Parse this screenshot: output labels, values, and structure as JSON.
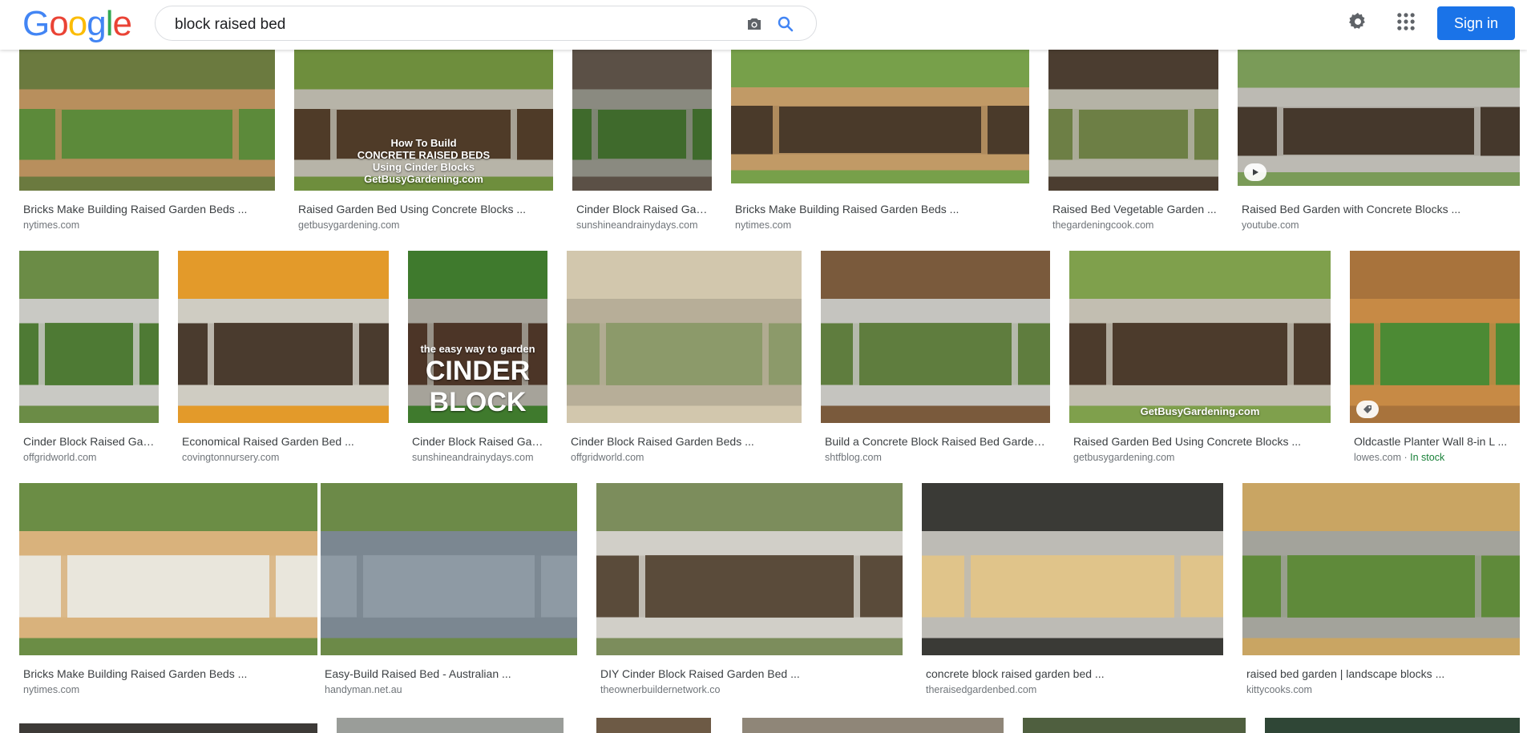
{
  "header": {
    "search_query": "block raised bed",
    "sign_in_label": "Sign in",
    "logo_text": "Google",
    "logo_colors": [
      "#4285f4",
      "#ea4335",
      "#fbbc05",
      "#4285f4",
      "#34a853",
      "#ea4335"
    ]
  },
  "results": [
    {
      "caption": "Bricks Make Building Raised Garden Beds ...",
      "domain": "nytimes.com",
      "img": [
        "#b88f5d",
        "#5c8a3a",
        "#6b7a3f"
      ]
    },
    {
      "caption": "Raised Garden Bed Using Concrete Blocks ...",
      "domain": "getbusygardening.com",
      "img": [
        "#b7b4a8",
        "#4f3b28",
        "#6e8e3d"
      ],
      "overlay": [
        "How To Build",
        "CONCRETE RAISED BEDS",
        "Using Cinder Blocks",
        "GetBusyGardening.com"
      ]
    },
    {
      "caption": "Cinder Block Raised Garden Beds ...",
      "domain": "sunshineandrainydays.com",
      "img": [
        "#8a8a80",
        "#3f6a2c",
        "#5b5046"
      ]
    },
    {
      "caption": "Bricks Make Building Raised Garden Beds ...",
      "domain": "nytimes.com",
      "img": [
        "#c19a66",
        "#4a3a2a",
        "#77a04a"
      ]
    },
    {
      "caption": "Raised Bed Vegetable Garden ...",
      "domain": "thegardeningcook.com",
      "img": [
        "#b5b3a6",
        "#6d7f45",
        "#4b3d30"
      ]
    },
    {
      "caption": "Raised Bed Garden with Concrete Blocks ...",
      "domain": "youtube.com",
      "img": [
        "#bcbab3",
        "#45382c",
        "#7a9b58"
      ],
      "badge": "play"
    },
    {
      "caption": "Cinder Block Raised Garden Beds ...",
      "domain": "offgridworld.com",
      "img": [
        "#c9c9c4",
        "#4e7a34",
        "#6b8c46"
      ]
    },
    {
      "caption": "Economical Raised Garden Bed ...",
      "domain": "covingtonnursery.com",
      "img": [
        "#cfccc2",
        "#4a3b2e",
        "#e39a2a"
      ]
    },
    {
      "caption": "Cinder Block Raised Garden Beds ...",
      "domain": "sunshineandrainydays.com",
      "img": [
        "#a6a39a",
        "#4c3527",
        "#3f7a2d"
      ],
      "overlay": [
        "the easy way to garden",
        "CINDER",
        "BLOCK"
      ]
    },
    {
      "caption": "Cinder Block Raised Garden Beds ...",
      "domain": "offgridworld.com",
      "img": [
        "#b7ae98",
        "#8c9a6a",
        "#d2c7ad"
      ]
    },
    {
      "caption": "Build a Concrete Block Raised Bed Garden ...",
      "domain": "shtfblog.com",
      "img": [
        "#c5c4bf",
        "#5f7d3e",
        "#7a5a3c"
      ]
    },
    {
      "caption": "Raised Garden Bed Using Concrete Blocks ...",
      "domain": "getbusygardening.com",
      "img": [
        "#c2beb1",
        "#4c3b2c",
        "#7fa04c"
      ],
      "overlay": [
        "GetBusyGardening.com"
      ]
    },
    {
      "caption": "Oldcastle Planter Wall 8-in L ...",
      "domain": "lowes.com",
      "stock": "In stock",
      "img": [
        "#c78a45",
        "#4c8a34",
        "#a8733c"
      ],
      "badge": "tag"
    },
    {
      "caption": "Bricks Make Building Raised Garden Beds ...",
      "domain": "nytimes.com",
      "img": [
        "#d9b27c",
        "#e9e6dc",
        "#6b8d45"
      ]
    },
    {
      "caption": "Easy-Build Raised Bed - Australian ...",
      "domain": "handyman.net.au",
      "img": [
        "#7b8791",
        "#8e9aa4",
        "#6c8a48"
      ]
    },
    {
      "caption": "DIY Cinder Block Raised Garden Bed ...",
      "domain": "theownerbuildernetwork.co",
      "img": [
        "#d1cfc8",
        "#5a4b3a",
        "#7c8d5c"
      ]
    },
    {
      "caption": "concrete block raised garden bed ...",
      "domain": "theraisedgardenbed.com",
      "img": [
        "#bdbbb5",
        "#e0c48a",
        "#3a3a36"
      ]
    },
    {
      "caption": "raised bed garden | landscape blocks ...",
      "domain": "kittycooks.com",
      "img": [
        "#a3a39b",
        "#5f8a3a",
        "#c9a563"
      ]
    }
  ]
}
